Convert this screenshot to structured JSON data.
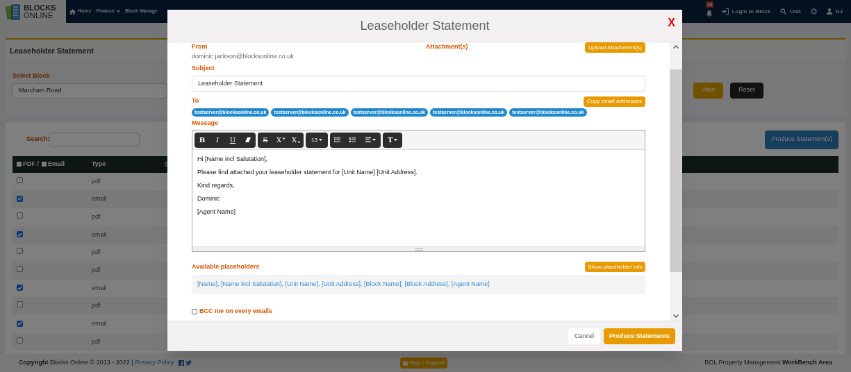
{
  "navbar": {
    "logo_top": "BLOCKS",
    "logo_bottom": "ONLINE",
    "items": [
      {
        "label": "Home",
        "kind": "home"
      },
      {
        "label": "Finance",
        "kind": "dropdown"
      },
      {
        "label": "Block Manage",
        "kind": "plain"
      }
    ],
    "notifications": "48",
    "right_items": [
      {
        "label": "Login to Block",
        "kind": "login"
      },
      {
        "label": "Unit",
        "kind": "search"
      },
      {
        "kind": "gear"
      },
      {
        "label": "DJ",
        "kind": "user"
      }
    ]
  },
  "page": {
    "title": "Leaseholder Statement",
    "select_block_label": "Select Block",
    "select_block_value": "Marcham Road",
    "view_button": "View",
    "reset_button": "Reset",
    "search_label": "Search:",
    "produce_button": "Produce Statement(s)",
    "table": {
      "columns": [
        {
          "label": "PDF / ",
          "kind": "pdf",
          "checked": false
        },
        {
          "label": "Email",
          "kind": "email",
          "checked": false
        },
        {
          "label": "Type",
          "kind": "sort"
        }
      ],
      "rows": [
        {
          "checked": false,
          "type": "pdf"
        },
        {
          "checked": true,
          "type": "email"
        },
        {
          "checked": false,
          "type": "pdf"
        },
        {
          "checked": true,
          "type": "email"
        },
        {
          "checked": false,
          "type": "pdf"
        },
        {
          "checked": false,
          "type": "pdf"
        },
        {
          "checked": true,
          "type": "email"
        },
        {
          "checked": false,
          "type": "pdf"
        },
        {
          "checked": true,
          "type": "email"
        },
        {
          "checked": false,
          "type": "pdf"
        }
      ]
    }
  },
  "modal": {
    "title": "Leaseholder Statement",
    "close": "X",
    "from_label": "From",
    "from_value": "dominic.jackson@blocksonline.co.uk",
    "attachments_label": "Attachment(s)",
    "upload_button": "Upload Attachment(s)",
    "subject_label": "Subject",
    "subject_value": "Leaseholder Statement",
    "to_label": "To",
    "copy_button": "Copy email addresses",
    "recipients": [
      "testserver@blocksonline.co.uk",
      "testserver@blocksonline.co.uk",
      "testserver@blocksonline.co.uk",
      "testserver@blocksonline.co.uk",
      "testserver@blocksonline.co.uk"
    ],
    "message_label": "Message",
    "toolbar": [
      [
        {
          "kind": "bold",
          "label": "B"
        },
        {
          "kind": "italic",
          "label": "I"
        },
        {
          "kind": "underline",
          "label": "U"
        },
        {
          "kind": "eraser"
        }
      ],
      [
        {
          "kind": "strike",
          "label": "S"
        },
        {
          "kind": "sup",
          "label": "X"
        },
        {
          "kind": "sub",
          "label": "X"
        }
      ],
      [
        {
          "kind": "size",
          "label": "13"
        }
      ],
      [
        {
          "kind": "ul"
        },
        {
          "kind": "ol"
        },
        {
          "kind": "align"
        }
      ],
      [
        {
          "kind": "style",
          "label": "T"
        }
      ]
    ],
    "message_lines": [
      "Hi [Name incl Salutation],",
      "Please find attached your leaseholder statement for [Unit Name] [Unit Address].",
      "Kind regards,",
      "Dominic",
      "[Agent Name]"
    ],
    "placeholders_label": "Available placeholders",
    "placeholder_info_button": "Show placeholder info",
    "placeholders": "[Name], [Name incl Salutation], [Unit Name], [Unit Address], [Block Name], [Block Address], [Agent Name]",
    "bcc": {
      "label": "BCC me on every emails",
      "checked": false
    },
    "cancel_button": "Cancel",
    "produce_button": "Produce Statements"
  },
  "footer": {
    "copyright": "**Copyright** Blocks Online © 2013 - 2022 |",
    "privacy": "Privacy Policy",
    "help": "Help / Support",
    "area": "BOL Property Management **WorkBench Area**"
  }
}
